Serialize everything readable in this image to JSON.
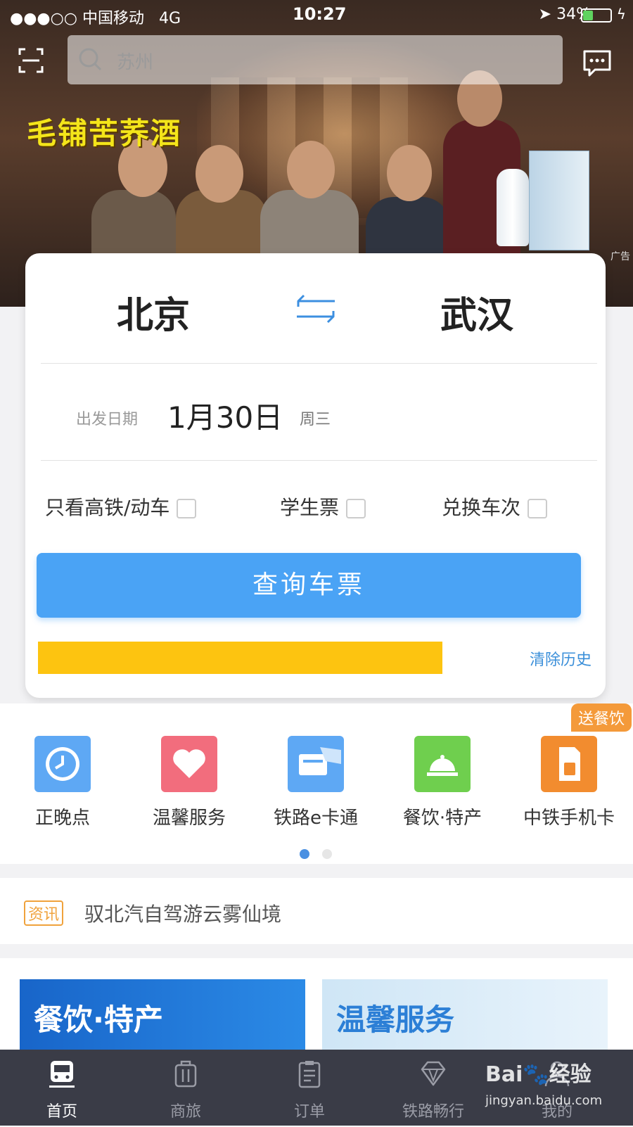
{
  "status_bar": {
    "carrier": "●●●○○ 中国移动",
    "network": "4G",
    "time": "10:27",
    "battery": "34%"
  },
  "search": {
    "placeholder": "苏州"
  },
  "banner": {
    "title": "毛铺苦荞酒",
    "ad_tag": "广告"
  },
  "booking": {
    "from_city": "北京",
    "to_city": "武汉",
    "date_label": "出发日期",
    "date_value": "1月30日",
    "weekday": "周三",
    "options": [
      {
        "label": "只看高铁/动车",
        "checked": false
      },
      {
        "label": "学生票",
        "checked": false
      },
      {
        "label": "兑换车次",
        "checked": false
      }
    ],
    "query_button": "查询车票",
    "clear_history": "清除历史"
  },
  "services": {
    "items": [
      {
        "label": "正晚点",
        "icon": "clock-icon",
        "color": "#5ea8f4"
      },
      {
        "label": "温馨服务",
        "icon": "heart-icon",
        "color": "#f26d7d"
      },
      {
        "label": "铁路e卡通",
        "icon": "card-icon",
        "color": "#5ea8f4"
      },
      {
        "label": "餐饮·特产",
        "icon": "service-bell-icon",
        "color": "#6fcf4e"
      },
      {
        "label": "中铁手机卡",
        "icon": "sim-card-icon",
        "color": "#f28c2f"
      }
    ],
    "badge": "送餐饮",
    "page_indicator": {
      "current": 1,
      "total": 2
    }
  },
  "news": {
    "tag": "资讯",
    "text": "驭北汽自驾游云雾仙境"
  },
  "promos": [
    {
      "title": "餐饮·特产"
    },
    {
      "title": "温馨服务"
    }
  ],
  "tabbar": {
    "items": [
      {
        "label": "首页",
        "icon": "train-icon",
        "active": true
      },
      {
        "label": "商旅",
        "icon": "luggage-icon",
        "active": false
      },
      {
        "label": "订单",
        "icon": "clipboard-icon",
        "active": false
      },
      {
        "label": "铁路畅行",
        "icon": "diamond-icon",
        "active": false
      },
      {
        "label": "我的",
        "icon": "user-icon",
        "active": false
      }
    ]
  },
  "watermark": {
    "brand": "Bai🐾经验",
    "url": "jingyan.baidu.com"
  },
  "colors": {
    "accent": "#4aa3f5",
    "history_bar": "#fdc410",
    "link": "#3b8fd9",
    "tabbar": "#3a3c47"
  }
}
